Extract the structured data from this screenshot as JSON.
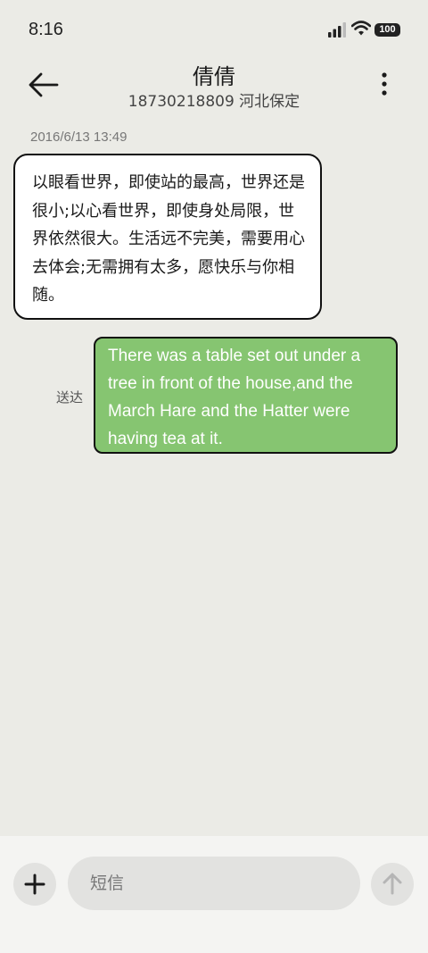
{
  "status_bar": {
    "time": "8:16",
    "battery": "100",
    "icons": [
      "signal-icon",
      "wifi-icon",
      "battery-icon"
    ]
  },
  "header": {
    "contact_name": "倩倩",
    "subtitle": "18730218809 河北保定",
    "back_icon": "arrow-left-icon",
    "more_icon": "more-vertical-icon"
  },
  "conversation": {
    "timestamp": "2016/6/13 13:49",
    "messages": [
      {
        "direction": "incoming",
        "text": "以眼看世界，即使站的最高，世界还是很小;以心看世界，即使身处局限，世界依然很大。生活远不完美，需要用心去体会;无需拥有太多，愿快乐与你相随。"
      },
      {
        "direction": "outgoing",
        "text": "There was a table set out under a tree in front of the house,and the March Hare and the Hatter were having tea at it.",
        "status": "送达"
      }
    ]
  },
  "compose": {
    "placeholder": "短信",
    "add_icon": "plus-icon",
    "send_icon": "arrow-up-icon"
  },
  "colors": {
    "background": "#ebebe6",
    "outgoing_bubble": "#86c571",
    "incoming_bubble": "#ffffff",
    "compose_bar": "#f4f4f2"
  }
}
